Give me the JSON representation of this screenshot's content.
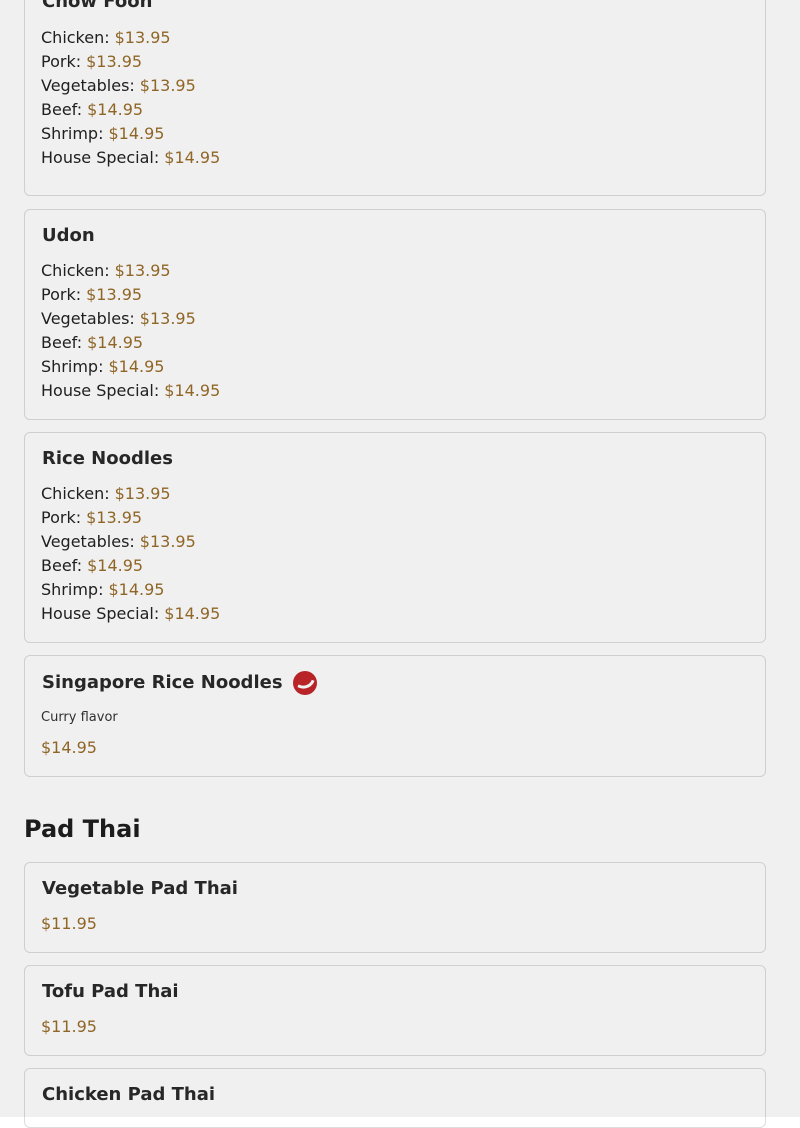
{
  "menu_glyph": "",
  "noodle_sections": [
    {
      "title": "Chow Foon",
      "icon": "",
      "items": [
        {
          "label": "Chicken:",
          "price": "$13.95"
        },
        {
          "label": "Pork:",
          "price": "$13.95"
        },
        {
          "label": "Vegetables:",
          "price": "$13.95"
        },
        {
          "label": "Beef:",
          "price": "$14.95"
        },
        {
          "label": "Shrimp:",
          "price": "$14.95"
        },
        {
          "label": "House Special:",
          "price": "$14.95"
        }
      ]
    },
    {
      "title": "Udon",
      "icon": "",
      "items": [
        {
          "label": "Chicken:",
          "price": "$13.95"
        },
        {
          "label": "Pork:",
          "price": "$13.95"
        },
        {
          "label": "Vegetables:",
          "price": "$13.95"
        },
        {
          "label": "Beef:",
          "price": "$14.95"
        },
        {
          "label": "Shrimp:",
          "price": "$14.95"
        },
        {
          "label": "House Special:",
          "price": "$14.95"
        }
      ]
    },
    {
      "title": "Rice Noodles",
      "icon": "",
      "items": [
        {
          "label": "Chicken:",
          "price": "$13.95"
        },
        {
          "label": "Pork:",
          "price": "$13.95"
        },
        {
          "label": "Vegetables:",
          "price": "$13.95"
        },
        {
          "label": "Beef:",
          "price": "$14.95"
        },
        {
          "label": "Shrimp:",
          "price": "$14.95"
        },
        {
          "label": "House Special:",
          "price": "$14.95"
        }
      ]
    }
  ],
  "singapore": {
    "title": "Singapore Rice Noodles",
    "icon": "",
    "description": "Curry flavor",
    "price": "$14.95",
    "badge_icon": "spicy-pepper-icon",
    "badge_color": "#c4262a"
  },
  "pad_thai": {
    "heading": "Pad Thai",
    "items": [
      {
        "title": "Vegetable Pad Thai",
        "icon": "",
        "price": "$11.95"
      },
      {
        "title": "Tofu Pad Thai",
        "icon": "",
        "price": "$11.95"
      },
      {
        "title": "Chicken Pad Thai",
        "icon": ""
      }
    ]
  },
  "colors": {
    "price": "#9a6d2a",
    "card_border": "#dcdcdc",
    "spicy_badge": "#c4262a"
  }
}
